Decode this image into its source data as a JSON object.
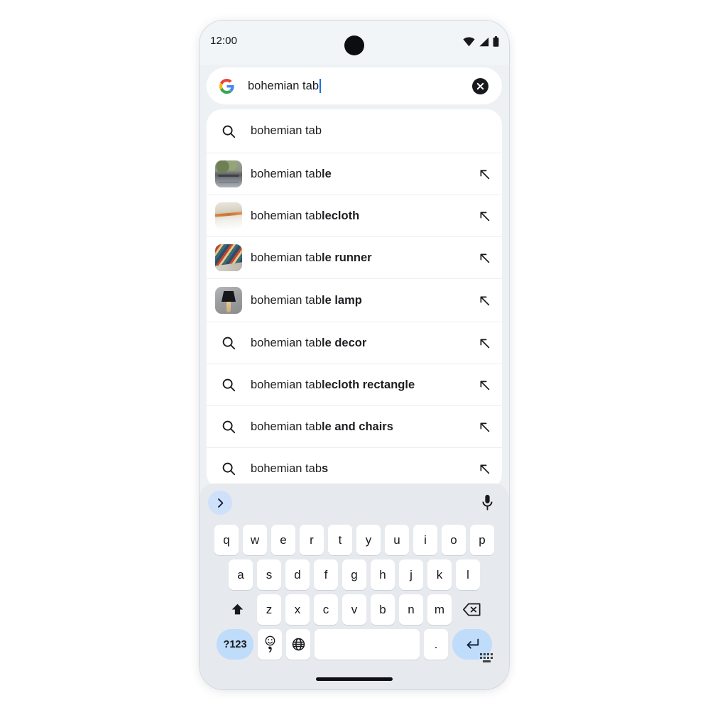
{
  "status_bar": {
    "time": "12:00",
    "icons": [
      "wifi-icon",
      "cellular-signal-icon",
      "battery-icon"
    ]
  },
  "search_bar": {
    "logo": "google-g-logo",
    "query": "bohemian tab",
    "has_caret": true,
    "caret_color": "#1a73e8",
    "clear_icon": "clear-circle-icon"
  },
  "suggestions": [
    {
      "lead": "search-icon",
      "prefix": "bohemian tab",
      "bold": "",
      "trailing": null
    },
    {
      "lead": "thumbnail-table",
      "prefix": "bohemian tab",
      "bold": "le",
      "trailing": "arrow-northwest-icon"
    },
    {
      "lead": "thumbnail-tablecloth",
      "prefix": "bohemian tab",
      "bold": "lecloth",
      "trailing": "arrow-northwest-icon"
    },
    {
      "lead": "thumbnail-runner",
      "prefix": "bohemian tab",
      "bold": "le runner",
      "trailing": "arrow-northwest-icon"
    },
    {
      "lead": "thumbnail-lamp",
      "prefix": "bohemian tab",
      "bold": "le lamp",
      "trailing": "arrow-northwest-icon"
    },
    {
      "lead": "search-icon",
      "prefix": "bohemian tab",
      "bold": "le decor",
      "trailing": "arrow-northwest-icon"
    },
    {
      "lead": "search-icon",
      "prefix": "bohemian tab",
      "bold": "lecloth rectangle",
      "trailing": "arrow-northwest-icon"
    },
    {
      "lead": "search-icon",
      "prefix": "bohemian tab",
      "bold": "le and chairs",
      "trailing": "arrow-northwest-icon"
    },
    {
      "lead": "search-icon",
      "prefix": "bohemian tab",
      "bold": "s",
      "trailing": "arrow-northwest-icon"
    }
  ],
  "keyboard": {
    "toolbar": {
      "expand_icon": "chevron-right-icon",
      "mic_icon": "microphone-icon"
    },
    "row1": [
      "q",
      "w",
      "e",
      "r",
      "t",
      "y",
      "u",
      "i",
      "o",
      "p"
    ],
    "row2": [
      "a",
      "s",
      "d",
      "f",
      "g",
      "h",
      "j",
      "k",
      "l"
    ],
    "row3_letters": [
      "z",
      "x",
      "c",
      "v",
      "b",
      "n",
      "m"
    ],
    "shift_icon": "shift-icon",
    "backspace_icon": "backspace-icon",
    "symbols_label": "?123",
    "emoji_icon": "emoji-comma-icon",
    "globe_icon": "language-globe-icon",
    "space_label": "",
    "period_label": ".",
    "enter_icon": "enter-return-icon",
    "switcher_icon": "keyboard-switcher-icon"
  },
  "nav": {
    "gesture_handle": "home-gesture-bar"
  },
  "colors": {
    "phone_bg": "#eef1f4",
    "status_bg": "#f2f5f7",
    "card_bg": "#ffffff",
    "keyboard_bg": "#e6e9ed",
    "key_bg": "#ffffff",
    "accent_blue": "#bfdcfb",
    "caret_blue": "#1a73e8",
    "text": "#1c1e21"
  }
}
